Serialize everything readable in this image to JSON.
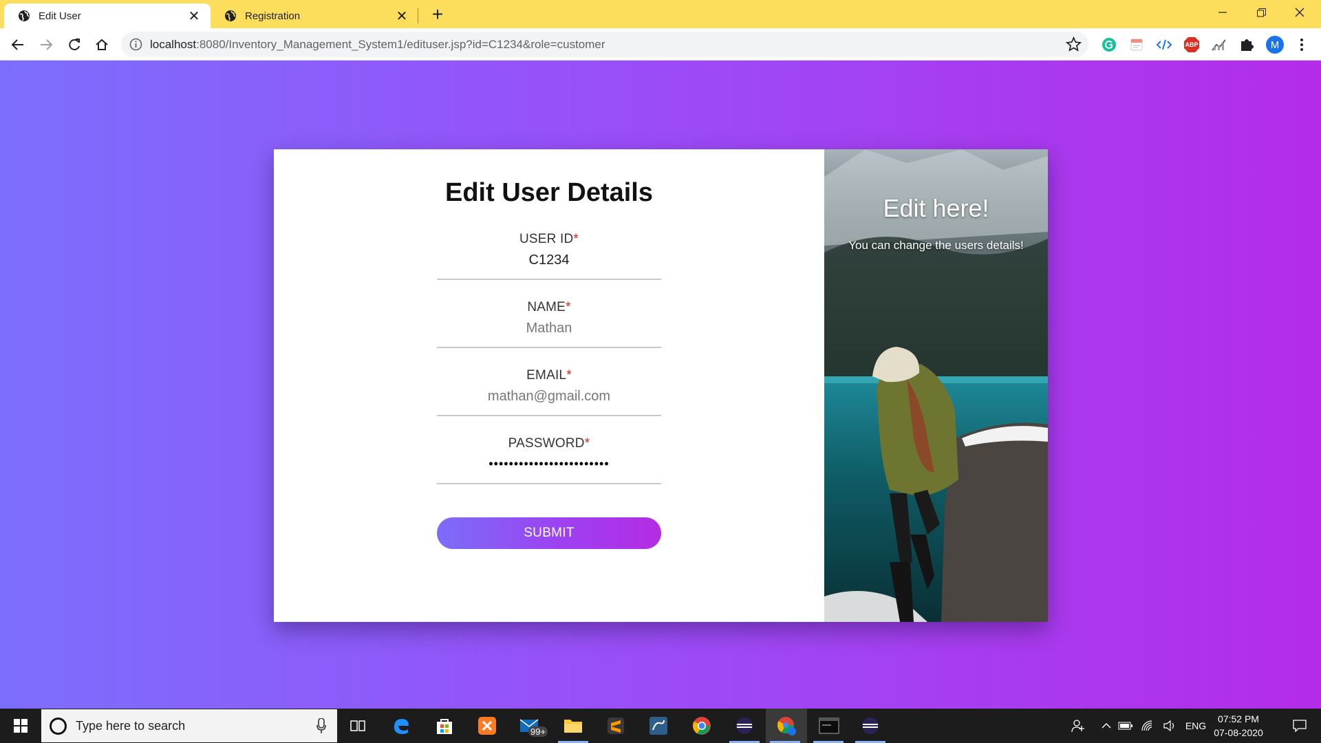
{
  "browser": {
    "tabs": [
      {
        "title": "Edit User",
        "active": true
      },
      {
        "title": "Registration",
        "active": false
      }
    ],
    "url_host": "localhost",
    "url_rest": ":8080/Inventory_Management_System1/edituser.jsp?id=C1234&role=customer",
    "profile_initial": "M",
    "extensions": [
      "grammarly-icon",
      "memo-icon",
      "code-icon",
      "adblock-icon",
      "stats-icon",
      "puzzle-icon"
    ],
    "adblock_label": "ABP"
  },
  "form": {
    "title": "Edit User Details",
    "fields": [
      {
        "label": "USER ID",
        "required_mark": "*",
        "value": "C1234"
      },
      {
        "label": "NAME",
        "required_mark": "*",
        "value": "Mathan"
      },
      {
        "label": "EMAIL",
        "required_mark": "*",
        "value": "mathan@gmail.com"
      },
      {
        "label": "PASSWORD",
        "required_mark": "*",
        "value": "••••••••••••••••••••••••"
      }
    ],
    "submit_label": "SUBMIT"
  },
  "side_panel": {
    "title": "Edit here!",
    "subtitle": "You can change the users details!"
  },
  "taskbar": {
    "search_placeholder": "Type here to search",
    "mail_badge": "99+",
    "language": "ENG",
    "time": "07:52 PM",
    "date": "07-08-2020"
  },
  "colors": {
    "tabstrip": "#fdde5c",
    "gradient_start": "#7c6efd",
    "gradient_end": "#b42ce8",
    "required": "#e02020"
  }
}
